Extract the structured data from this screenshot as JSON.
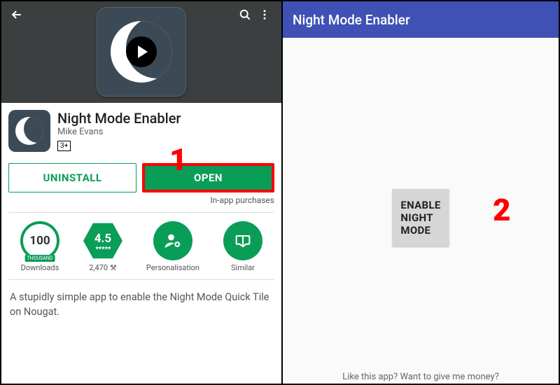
{
  "left": {
    "app_title": "Night Mode Enabler",
    "developer": "Mike Evans",
    "age_rating": "3+",
    "buttons": {
      "uninstall": "UNINSTALL",
      "open": "OPEN"
    },
    "iap_label": "In-app purchases",
    "stats": {
      "downloads": {
        "value": "100",
        "unit": "THOUSAND",
        "label": "Downloads"
      },
      "rating": {
        "value": "4.5",
        "count": "2,470",
        "label_suffix": " ⚒"
      },
      "personalisation": "Personalisation",
      "similar": "Similar"
    },
    "description": "A stupidly simple app to enable the Night Mode Quick Tile on Nougat.",
    "annotation": "1"
  },
  "right": {
    "appbar_title": "Night Mode Enabler",
    "button_label": "ENABLE NIGHT MODE",
    "annotation": "2",
    "footer": "Like this app? Want to give me money?"
  }
}
